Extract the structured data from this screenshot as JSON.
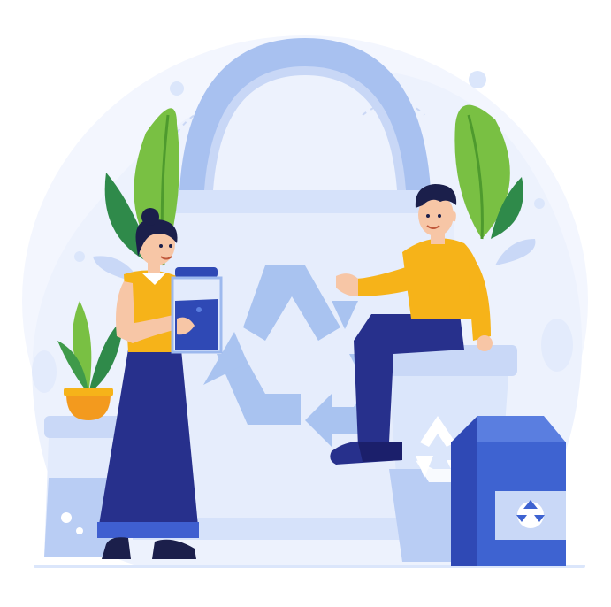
{
  "illustration": {
    "subject": "recycling",
    "palette": {
      "background_blob": "#eef3fd",
      "bag_light": "#dbe6fb",
      "bag_mid": "#b9cdf4",
      "bag_handle": "#9db9ee",
      "recycle_symbol": "#9fbcef",
      "navy": "#27308c",
      "blue": "#3f5fd0",
      "yellow": "#f6b319",
      "skin": "#ffffff",
      "skin_tone": "#f7c6a6",
      "hair": "#1b1f4b",
      "leaf_green": "#79c043",
      "leaf_dark": "#2f8a4a",
      "pot_orange": "#f39a1e",
      "jar_blue": "#2f49b5",
      "carton_blue": "#3e63d1",
      "carton_light": "#c9d8f7"
    },
    "icons": [
      "shopping-bag-icon",
      "recycle-icon",
      "jar-icon",
      "milk-carton-icon",
      "trash-bin-icon",
      "plant-icon"
    ]
  }
}
